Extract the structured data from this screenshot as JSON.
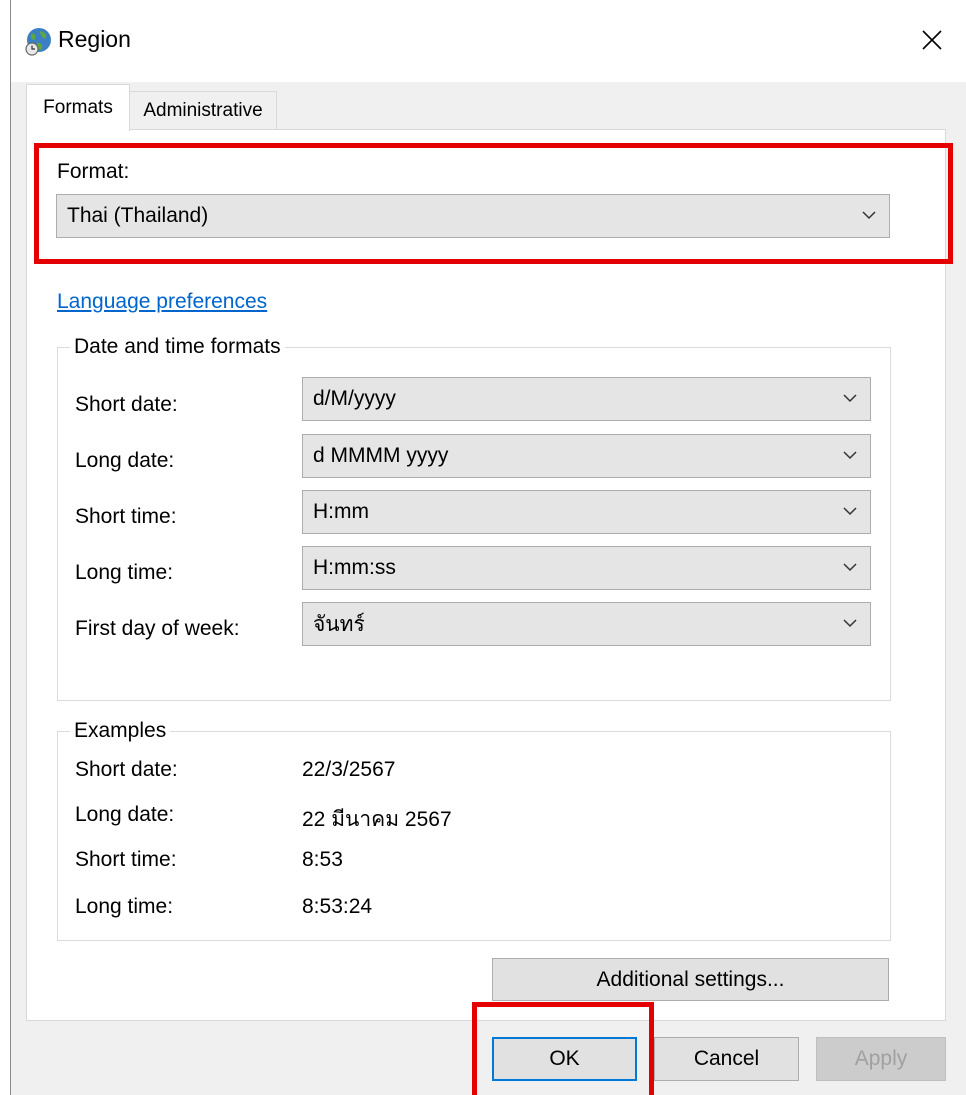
{
  "window": {
    "title": "Region",
    "icon": "globe-clock-icon",
    "close_icon": "close-icon"
  },
  "tabs": [
    {
      "label": "Formats",
      "selected": true
    },
    {
      "label": "Administrative",
      "selected": false
    }
  ],
  "format": {
    "label": "Format:",
    "value": "Thai (Thailand)"
  },
  "language_link": "Language preferences",
  "date_time_formats": {
    "caption": "Date and time formats",
    "rows": [
      {
        "label": "Short date:",
        "value": "d/M/yyyy"
      },
      {
        "label": "Long date:",
        "value": "d MMMM yyyy"
      },
      {
        "label": "Short time:",
        "value": "H:mm"
      },
      {
        "label": "Long time:",
        "value": "H:mm:ss"
      },
      {
        "label": "First day of week:",
        "value": "จันทร์"
      }
    ]
  },
  "examples": {
    "caption": "Examples",
    "rows": [
      {
        "label": "Short date:",
        "value": "22/3/2567"
      },
      {
        "label": "Long date:",
        "value": "22 มีนาคม 2567"
      },
      {
        "label": "Short time:",
        "value": "8:53"
      },
      {
        "label": "Long time:",
        "value": "8:53:24"
      }
    ]
  },
  "buttons": {
    "additional_settings": "Additional settings...",
    "ok": "OK",
    "cancel": "Cancel",
    "apply": "Apply"
  },
  "colors": {
    "link": "#0066cc",
    "highlight": "#e50000",
    "focus": "#0078d7"
  }
}
